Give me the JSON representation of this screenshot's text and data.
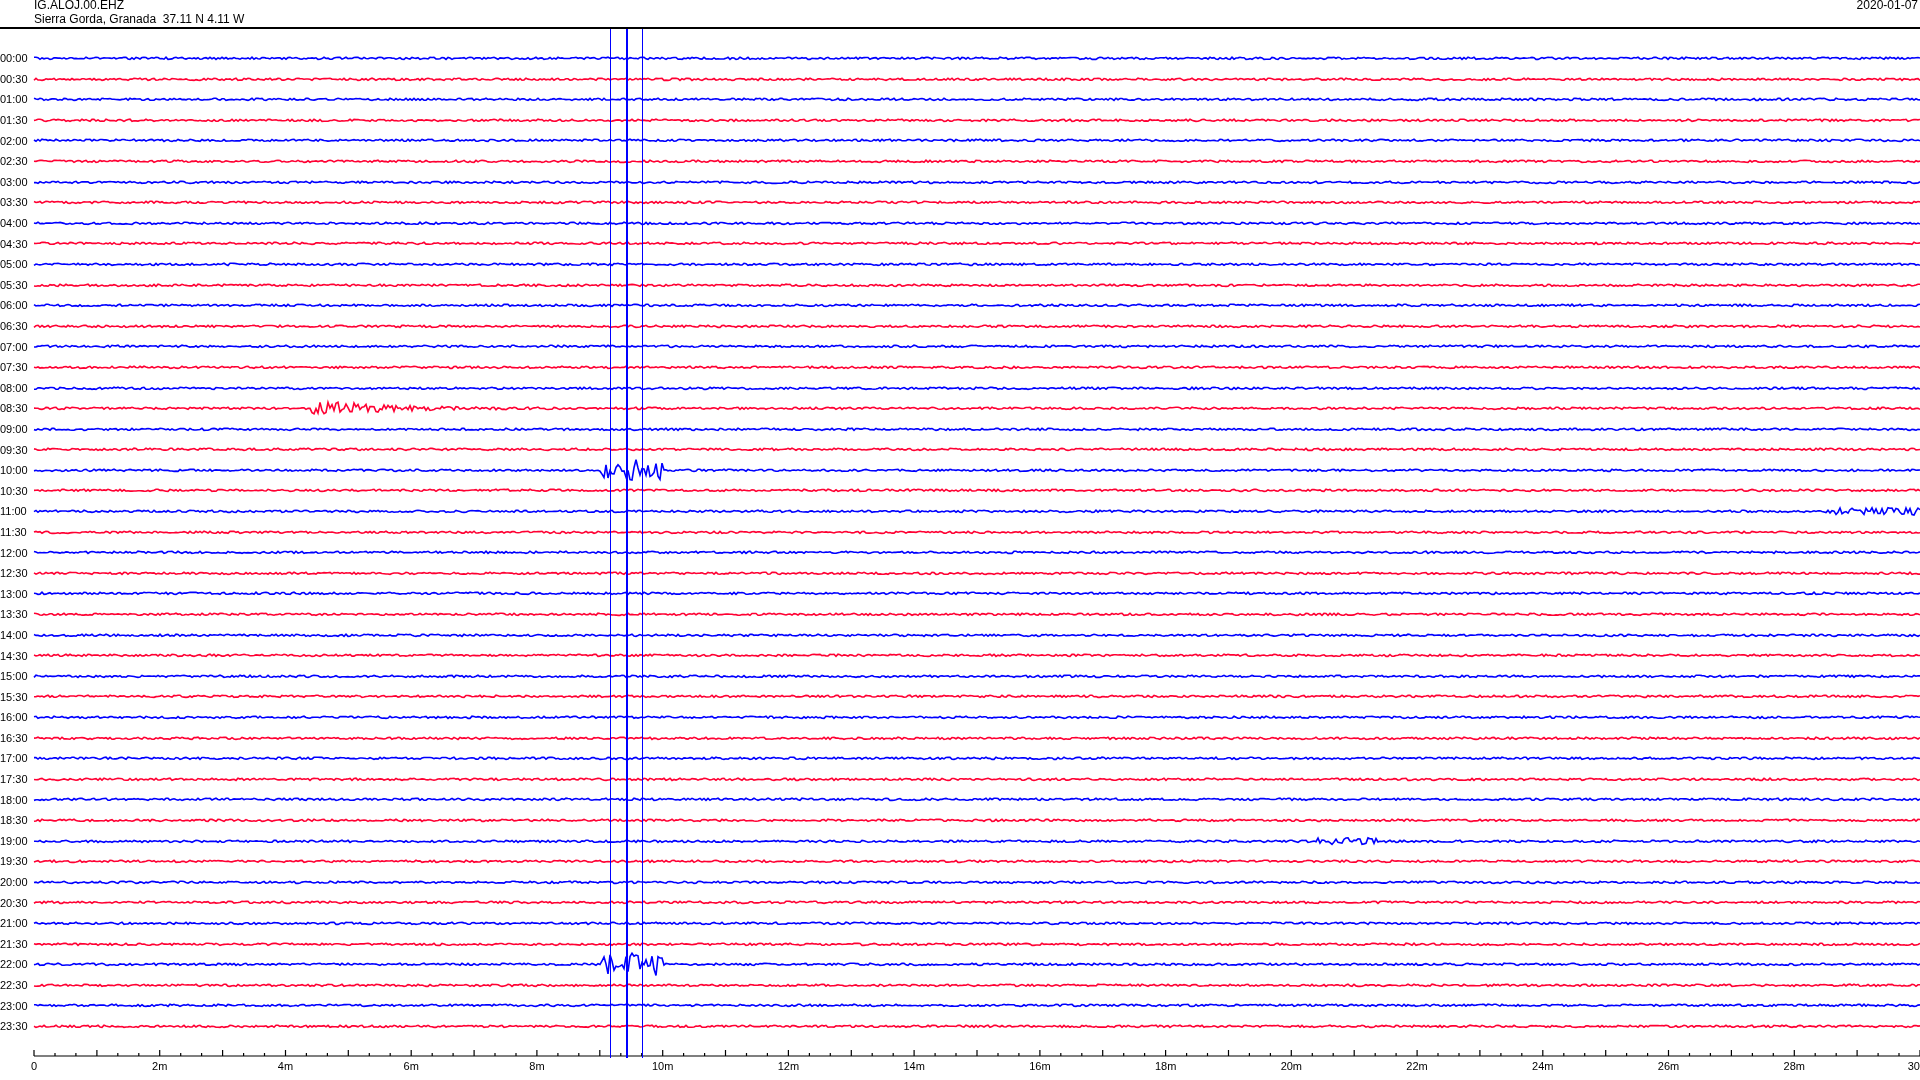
{
  "header": {
    "station": "IG.ALOJ.00.EHZ",
    "location": "Sierra Gorda, Granada  37.11 N 4.11 W",
    "date": "2020-01-07"
  },
  "rows": [
    {
      "label": "00:00",
      "color": "#0000ff"
    },
    {
      "label": "00:30",
      "color": "#ff0033"
    },
    {
      "label": "01:00",
      "color": "#0000ff"
    },
    {
      "label": "01:30",
      "color": "#ff0033"
    },
    {
      "label": "02:00",
      "color": "#0000ff"
    },
    {
      "label": "02:30",
      "color": "#ff0033"
    },
    {
      "label": "03:00",
      "color": "#0000ff"
    },
    {
      "label": "03:30",
      "color": "#ff0033"
    },
    {
      "label": "04:00",
      "color": "#0000ff"
    },
    {
      "label": "04:30",
      "color": "#ff0033"
    },
    {
      "label": "05:00",
      "color": "#0000ff"
    },
    {
      "label": "05:30",
      "color": "#ff0033"
    },
    {
      "label": "06:00",
      "color": "#0000ff"
    },
    {
      "label": "06:30",
      "color": "#ff0033"
    },
    {
      "label": "07:00",
      "color": "#0000ff"
    },
    {
      "label": "07:30",
      "color": "#ff0033"
    },
    {
      "label": "08:00",
      "color": "#0000ff"
    },
    {
      "label": "08:30",
      "color": "#ff0033"
    },
    {
      "label": "09:00",
      "color": "#0000ff"
    },
    {
      "label": "09:30",
      "color": "#ff0033"
    },
    {
      "label": "10:00",
      "color": "#0000ff"
    },
    {
      "label": "10:30",
      "color": "#ff0033"
    },
    {
      "label": "11:00",
      "color": "#0000ff"
    },
    {
      "label": "11:30",
      "color": "#ff0033"
    },
    {
      "label": "12:00",
      "color": "#0000ff"
    },
    {
      "label": "12:30",
      "color": "#ff0033"
    },
    {
      "label": "13:00",
      "color": "#0000ff"
    },
    {
      "label": "13:30",
      "color": "#ff0033"
    },
    {
      "label": "14:00",
      "color": "#0000ff"
    },
    {
      "label": "14:30",
      "color": "#ff0033"
    },
    {
      "label": "15:00",
      "color": "#0000ff"
    },
    {
      "label": "15:30",
      "color": "#ff0033"
    },
    {
      "label": "16:00",
      "color": "#0000ff"
    },
    {
      "label": "16:30",
      "color": "#ff0033"
    },
    {
      "label": "17:00",
      "color": "#0000ff"
    },
    {
      "label": "17:30",
      "color": "#ff0033"
    },
    {
      "label": "18:00",
      "color": "#0000ff"
    },
    {
      "label": "18:30",
      "color": "#ff0033"
    },
    {
      "label": "19:00",
      "color": "#0000ff"
    },
    {
      "label": "19:30",
      "color": "#ff0033"
    },
    {
      "label": "20:00",
      "color": "#0000ff"
    },
    {
      "label": "20:30",
      "color": "#ff0033"
    },
    {
      "label": "21:00",
      "color": "#0000ff"
    },
    {
      "label": "21:30",
      "color": "#ff0033"
    },
    {
      "label": "22:00",
      "color": "#0000ff"
    },
    {
      "label": "22:30",
      "color": "#ff0033"
    },
    {
      "label": "23:00",
      "color": "#0000ff"
    },
    {
      "label": "23:30",
      "color": "#ff0033"
    }
  ],
  "x_axis": {
    "ticks": [
      "0",
      "2m",
      "4m",
      "6m",
      "8m",
      "10m",
      "12m",
      "14m",
      "16m",
      "18m",
      "20m",
      "22m",
      "24m",
      "26m",
      "28m",
      "30"
    ]
  }
}
